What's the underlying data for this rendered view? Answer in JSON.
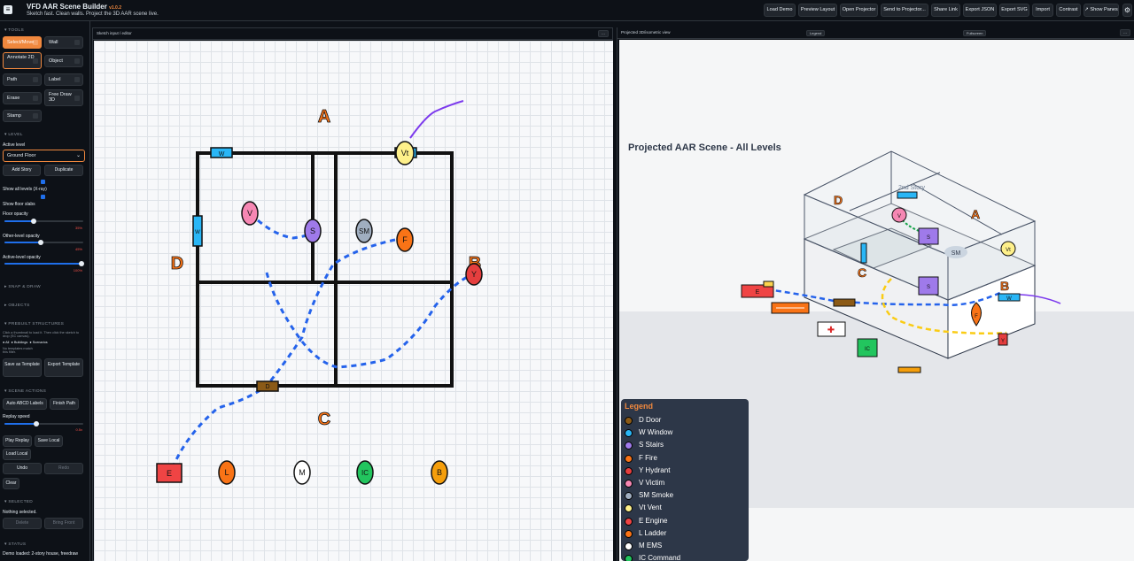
{
  "app": {
    "title": "VFD AAR Scene Builder",
    "version": "v1.0.2",
    "subtitle": "Sketch fast. Clean walls. Project the 3D AAR scene live."
  },
  "toolbar": [
    "Load Demo",
    "Preview Layout",
    "Open Projector",
    "Send to Projector...",
    "Share Link",
    "Export JSON",
    "Export SVG",
    "Import",
    "Contrast",
    "↗ Show Panes"
  ],
  "sidebar": {
    "tools_head": "TOOLS",
    "tools": [
      "Select/Move",
      "Wall",
      "Annotate 2D",
      "Object",
      "Path",
      "Label",
      "Erase",
      "Free Draw 3D",
      "Stamp"
    ],
    "level_head": "LEVEL",
    "active_level_label": "Active level",
    "active_level_value": "Ground Floor",
    "add_story": "Add Story",
    "duplicate": "Duplicate",
    "show_all_levels": "Show all levels (X-ray)",
    "show_floor_slabs": "Show floor slabs",
    "floor_opacity": "Floor opacity",
    "floor_opacity_val": "35%",
    "other_level_opacity": "Other-level opacity",
    "other_level_val": "45%",
    "active_level_opacity": "Active-level opacity",
    "active_level_val": "100%",
    "snap_head": "SNAP & DRAW",
    "objects_head": "OBJECTS",
    "prebuilt_head": "PREBUILT STRUCTURES",
    "prebuilt_help": "Click a thumbnail to load it. Then click the sketch to drop (SC canvas).",
    "filters": [
      "All",
      "Buildings",
      "Scenarios"
    ],
    "no_templates": "No templates match this filter.",
    "save_template": "Save as Template",
    "export_template": "Export Template",
    "scene_head": "SCENE ACTIONS",
    "auto_abcd": "Auto ABCD Labels",
    "finish_path": "Finish Path",
    "replay_speed": "Replay speed",
    "replay_val": "0.5x",
    "play_replay": "Play Replay",
    "save_local": "Save Local",
    "load_local": "Load Local",
    "undo": "Undo",
    "redo": "Redo",
    "clear": "Clear",
    "selected_head": "SELECTED",
    "nothing_selected": "Nothing selected.",
    "delete": "Delete",
    "bring_front": "Bring Front",
    "status_head": "STATUS",
    "status_text": "Demo loaded: 2-story house, freedraw"
  },
  "left_panel": {
    "title": "Sketch input / editor",
    "menu": "..."
  },
  "right_panel": {
    "title": "Projected 3D/isometric view",
    "legend_btn": "Legend",
    "fullscreen_btn": "Fullscreen",
    "menu": "..."
  },
  "sketch": {
    "side_labels": [
      "A",
      "B",
      "C",
      "D"
    ],
    "markers": {
      "window": "W",
      "vent": "Vt",
      "victim": "V",
      "stairs": "S",
      "smoke": "SM",
      "fire": "F",
      "hydrant": "Y",
      "door": "D"
    },
    "units": [
      "E",
      "L",
      "M",
      "IC",
      "B"
    ]
  },
  "scene3d": {
    "title": "Projected AAR Scene - All Levels",
    "story_label": "2nd Story",
    "labels": {
      "A": "A",
      "B": "B",
      "C": "C",
      "D": "D",
      "SM": "SM",
      "Vt": "Vt",
      "S": "S",
      "V": "V",
      "E": "E",
      "IC": "IC",
      "F": "F",
      "Y": "Y",
      "W": "W"
    }
  },
  "legend": {
    "title": "Legend",
    "items": [
      {
        "label": "D Door",
        "color": "#8b5a16"
      },
      {
        "label": "W Window",
        "color": "#29b6f6"
      },
      {
        "label": "S Stairs",
        "color": "#9f7aea"
      },
      {
        "label": "F Fire",
        "color": "#f97316"
      },
      {
        "label": "Y Hydrant",
        "color": "#e53e3e"
      },
      {
        "label": "V Victim",
        "color": "#f687b3"
      },
      {
        "label": "SM Smoke",
        "color": "#a0aec0"
      },
      {
        "label": "Vt Vent",
        "color": "#fef08a"
      },
      {
        "label": "E Engine",
        "color": "#ef4444"
      },
      {
        "label": "L Ladder",
        "color": "#f97316"
      },
      {
        "label": "M EMS",
        "color": "#ffffff"
      },
      {
        "label": "IC Command",
        "color": "#22c55e"
      }
    ]
  }
}
